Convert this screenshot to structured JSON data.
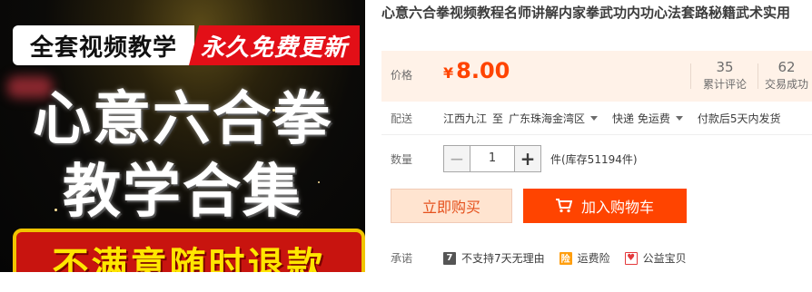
{
  "image": {
    "banner_left": "全套视频教学",
    "banner_right": "永久免费更新",
    "line1": "心意六合拳",
    "line2": "教学合集",
    "bottom": "不满意随时退款"
  },
  "product": {
    "title": "心意六合拳视频教程名师讲解内家拳武功内功心法套路秘籍武术实用"
  },
  "price": {
    "label": "价格",
    "currency": "¥",
    "amount": "8.00",
    "color": "#ff4400",
    "stats": [
      {
        "value": "35",
        "caption": "累计评论"
      },
      {
        "value": "62",
        "caption": "交易成功"
      }
    ]
  },
  "delivery": {
    "label": "配送",
    "from": "江西九江",
    "to_word": "至",
    "to": "广东珠海金湾区",
    "shipping": "快递 免运费",
    "ship_time": "付款后5天内发货"
  },
  "quantity": {
    "label": "数量",
    "minus": "−",
    "value": "1",
    "plus": "+",
    "stock": "件(库存51194件)"
  },
  "actions": {
    "buy_now": "立即购买",
    "add_to_cart": "加入购物车",
    "accent": "#ff4400"
  },
  "promise": {
    "label": "承诺",
    "items": [
      {
        "icon": "seven-day-icon",
        "glyph": "7",
        "text": "不支持7天无理由"
      },
      {
        "icon": "shipping-insurance-icon",
        "glyph": "险",
        "text": "运费险"
      },
      {
        "icon": "charity-icon",
        "glyph": "♥",
        "text": "公益宝贝"
      }
    ]
  }
}
